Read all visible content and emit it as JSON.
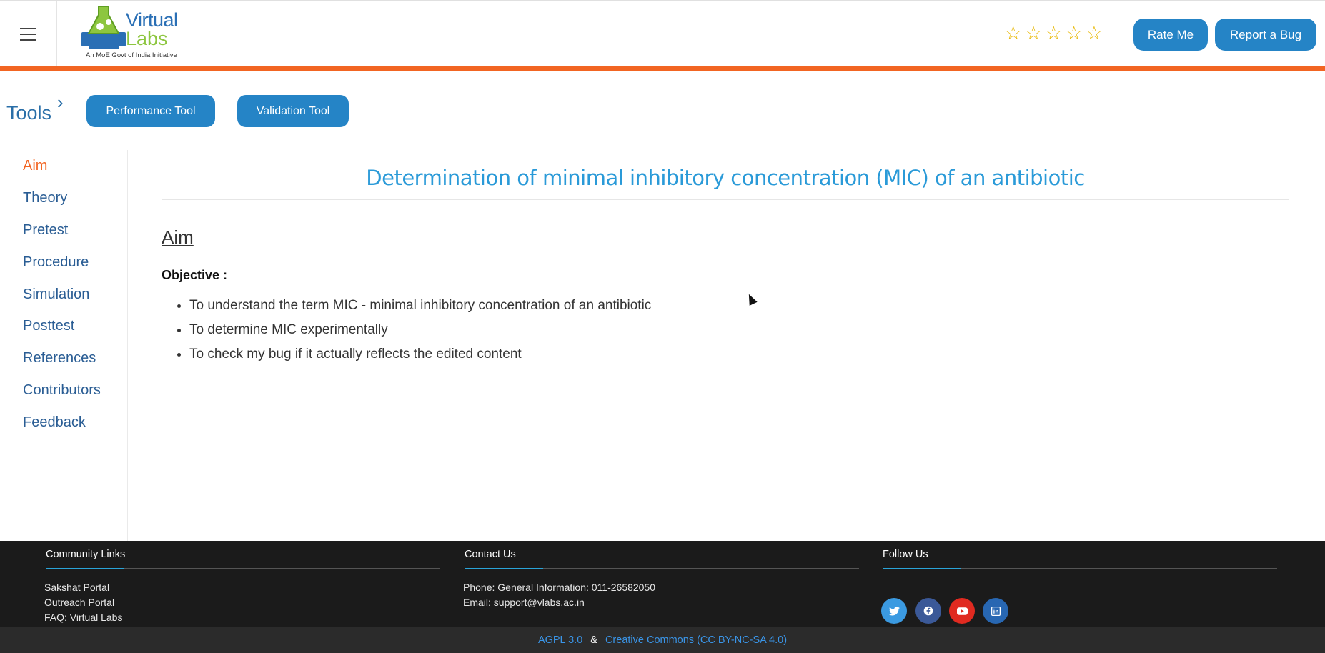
{
  "header": {
    "logo": {
      "line1": "Virtual",
      "line2": "Labs",
      "tagline": "An MoE Govt of India Initiative"
    },
    "rating_star_count": 5,
    "rate_label": "Rate Me",
    "bug_label": "Report a Bug"
  },
  "tools": {
    "label": "Tools",
    "buttons": [
      "Performance Tool",
      "Validation Tool"
    ]
  },
  "sidebar": {
    "items": [
      "Aim",
      "Theory",
      "Pretest",
      "Procedure",
      "Simulation",
      "Posttest",
      "References",
      "Contributors",
      "Feedback"
    ],
    "active": "Aim"
  },
  "main": {
    "title": "Determination of minimal inhibitory concentration (MIC) of an antibiotic",
    "section_heading": "Aim",
    "objective_label": "Objective :",
    "bullets": [
      "To understand the term MIC - minimal inhibitory concentration of an antibiotic",
      "To determine MIC experimentally",
      "To check my bug if it actually reflects the edited content"
    ]
  },
  "footer": {
    "community": {
      "heading": "Community Links",
      "links": [
        "Sakshat Portal",
        "Outreach Portal",
        "FAQ: Virtual Labs"
      ]
    },
    "contact": {
      "heading": "Contact Us",
      "phone": "Phone: General Information: 011-26582050",
      "email": "Email: support@vlabs.ac.in"
    },
    "follow": {
      "heading": "Follow Us",
      "icons": [
        "twitter-icon",
        "facebook-icon",
        "youtube-icon",
        "linkedin-icon"
      ]
    },
    "license1": "AGPL 3.0",
    "amp": "&",
    "license2": "Creative Commons (CC BY-NC-SA 4.0)"
  },
  "colors": {
    "accent": "#2584c6",
    "orange": "#f26522",
    "title": "#2a9ad8",
    "footer_bg": "#1b1b1b"
  }
}
